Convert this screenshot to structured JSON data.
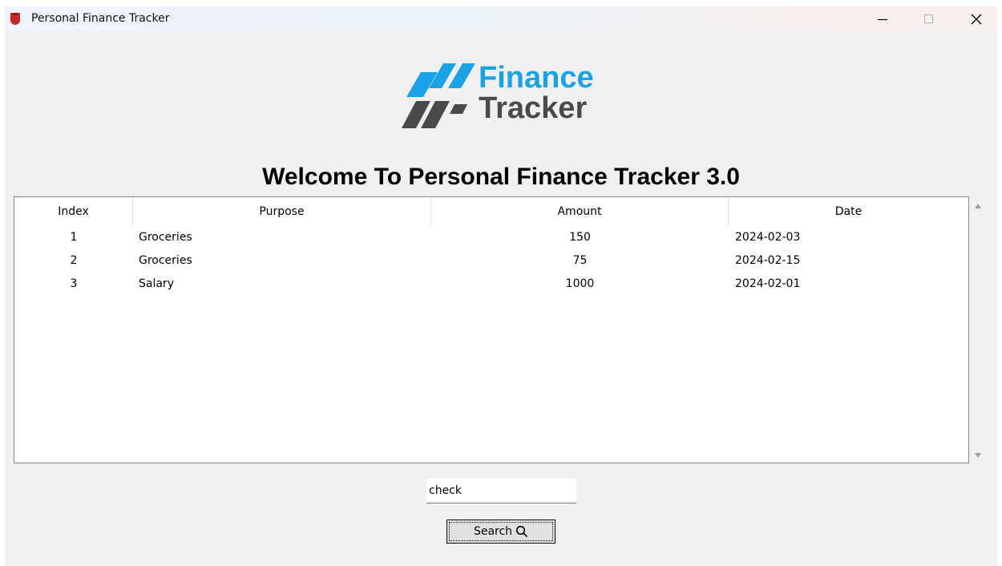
{
  "window": {
    "title": "Personal Finance Tracker"
  },
  "logo": {
    "line1": "Finance",
    "line2": "Tracker"
  },
  "heading": "Welcome To Personal Finance Tracker 3.0",
  "table": {
    "columns": [
      "Index",
      "Purpose",
      "Amount",
      "Date"
    ],
    "rows": [
      [
        "1",
        "Groceries",
        "150",
        "2024-02-03"
      ],
      [
        "2",
        "Groceries",
        "75",
        "2024-02-15"
      ],
      [
        "3",
        "Salary",
        "1000",
        "2024-02-01"
      ]
    ]
  },
  "search": {
    "value": "check",
    "button_label": "Search"
  },
  "colors": {
    "logo_blue": "#1ba1e6",
    "logo_gray": "#4a4a4a",
    "window_bg": "#f0f0f0"
  },
  "icons": {
    "app": "finance-app-icon",
    "search": "magnifier-icon"
  }
}
